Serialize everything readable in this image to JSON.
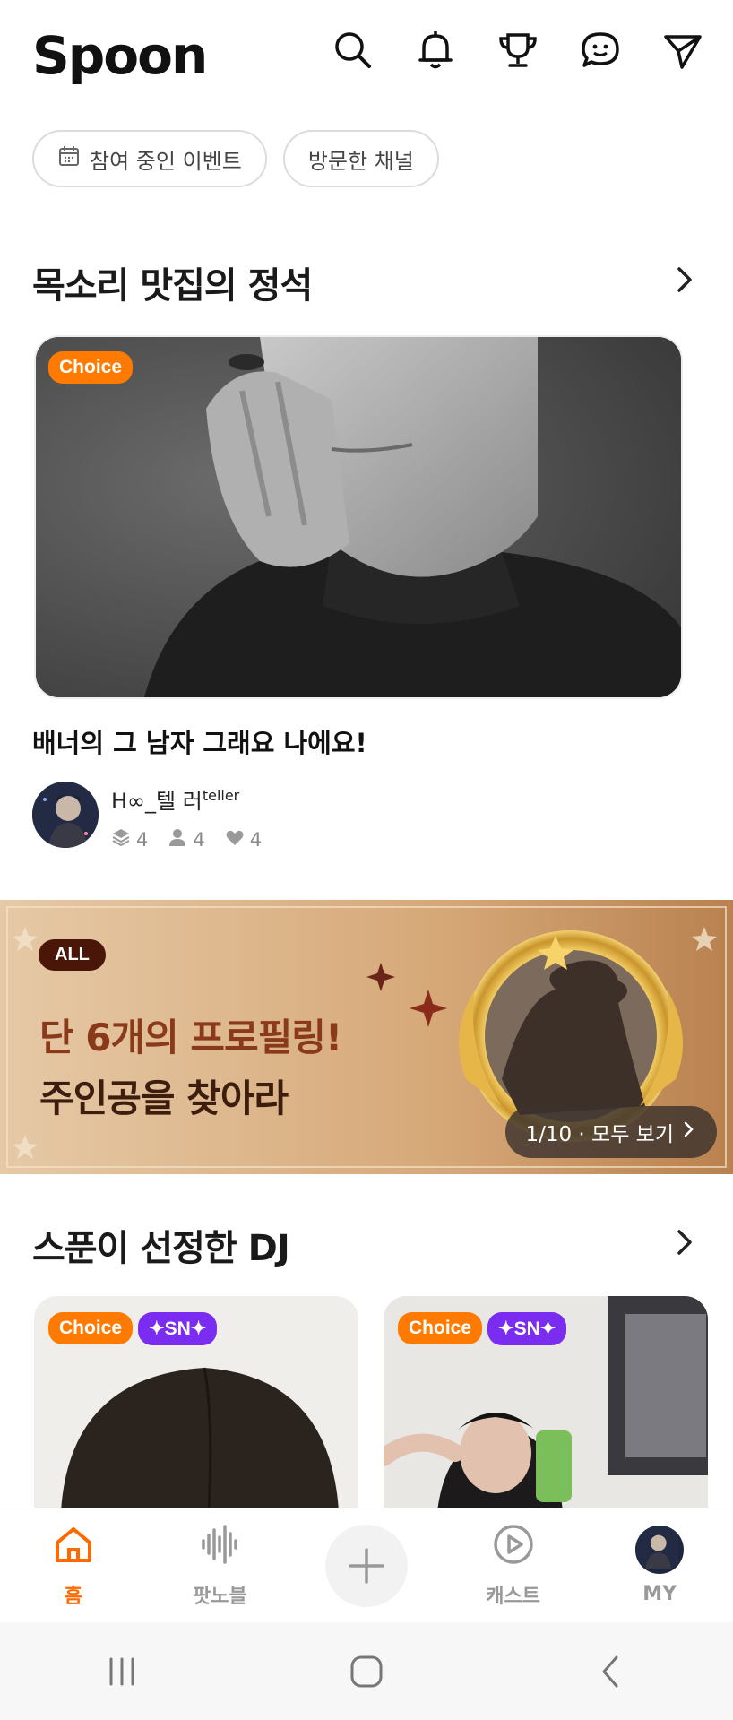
{
  "header": {
    "logo": "Spoon",
    "icons": [
      "search-icon",
      "bell-icon",
      "trophy-icon",
      "chat-icon",
      "send-icon"
    ]
  },
  "chips": [
    {
      "label": "참여 중인 이벤트",
      "icon": "calendar-icon"
    },
    {
      "label": "방문한 채널"
    }
  ],
  "section_voice": {
    "title": "목소리 맛집의 정석",
    "badge": "Choice",
    "post_title": "배너의 그 남자 그래요 나에요!",
    "dj_name": "H∞_텔 러",
    "dj_name_sup": "teller",
    "stats": {
      "casts": "4",
      "followers": "4",
      "likes": "4"
    }
  },
  "event_banner": {
    "tag": "ALL",
    "line1": "단 6개의 프로필링!",
    "line2": "주인공을 찾아라",
    "pager": "1/10 · 모두 보기"
  },
  "section_dj": {
    "title": "스푼이 선정한 DJ",
    "cards": [
      {
        "badge": "Choice",
        "badge2": "✦SN✦"
      },
      {
        "badge": "Choice",
        "badge2": "✦SN✦"
      }
    ]
  },
  "bottom_nav": {
    "items": [
      {
        "label": "홈",
        "icon": "home-icon",
        "active": true
      },
      {
        "label": "팟노블",
        "icon": "waveform-icon"
      },
      {
        "label": "",
        "icon": "plus-icon"
      },
      {
        "label": "캐스트",
        "icon": "play-circle-icon"
      },
      {
        "label": "MY",
        "icon": "avatar"
      }
    ]
  },
  "colors": {
    "accent": "#ff6a00",
    "choice_badge": "#ff7a00",
    "sn_badge": "#7a2cf0",
    "event_bg": "#c99866"
  }
}
